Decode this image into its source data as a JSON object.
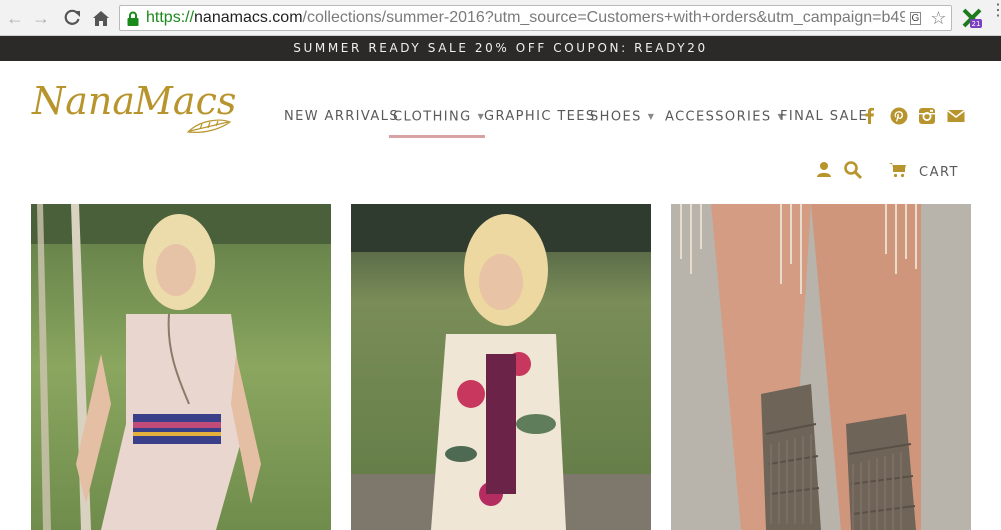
{
  "browser": {
    "url_scheme": "https://",
    "url_host": "nanamacs.com",
    "url_path": "/collections/summer-2016?utm_source=Customers+with+orders&utm_campaign=b49"
  },
  "announcement": {
    "text": "SUMMER READY SALE 20% OFF COUPON: READY20"
  },
  "brand": {
    "name": "NanaMacs",
    "color": "#b8942d"
  },
  "nav": {
    "items": [
      {
        "label": "NEW ARRIVALS",
        "has_dropdown": false
      },
      {
        "label": "CLOTHING",
        "has_dropdown": true,
        "active": true
      },
      {
        "label": "GRAPHIC TEES",
        "has_dropdown": false
      },
      {
        "label": "SHOES",
        "has_dropdown": true
      },
      {
        "label": "ACCESSORIES",
        "has_dropdown": true
      },
      {
        "label": "FINAL SALE",
        "has_dropdown": false
      }
    ],
    "active_underline_color": "#d6a2a2"
  },
  "social": [
    "facebook-icon",
    "pinterest-icon",
    "instagram-icon",
    "mail-icon"
  ],
  "utility": {
    "cart_label": "CART",
    "icons": [
      "account-icon",
      "search-icon",
      "cart-icon"
    ]
  },
  "accent_color": "#b8942d",
  "products": [
    {
      "image": "woman-in-blush-dress-with-embroidered-belt"
    },
    {
      "image": "woman-in-floral-kimono"
    },
    {
      "image": "fringe-gladiator-boots"
    }
  ]
}
